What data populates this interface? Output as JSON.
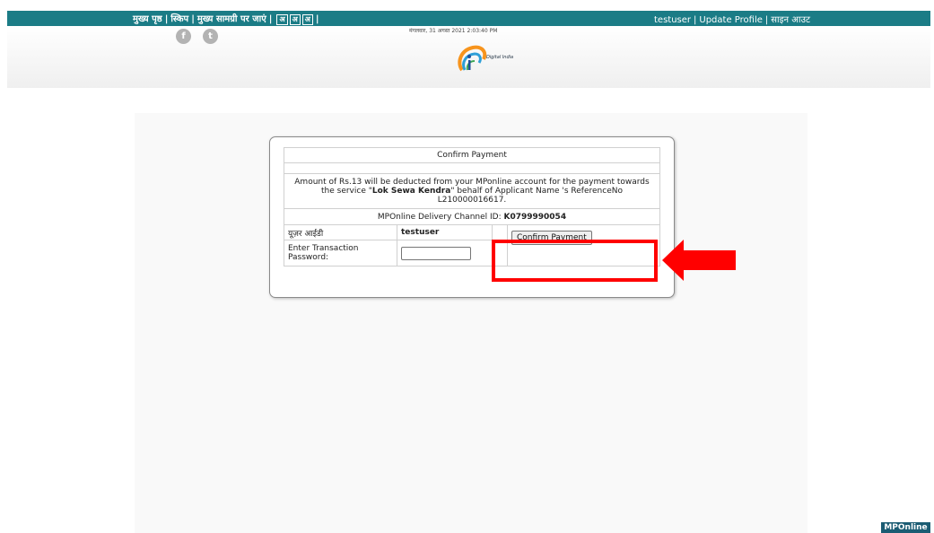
{
  "topbar": {
    "home": "मुख्य पृष्ठ",
    "skip": "स्किप",
    "main_content": "मुख्य सामग्री पर जाएं",
    "font_small": "अ",
    "font_normal": "अ",
    "font_large": "अ",
    "separator": "|",
    "username": "testuser",
    "update_profile": "Update Profile",
    "sign_out": "साइन आउट",
    "background": "#1b7c86"
  },
  "header": {
    "datetime": "मंगलवार, 31 अगस्त 2021 2:03:40 PM",
    "logo_text": "Digital India",
    "facebook_glyph": "f",
    "twitter_glyph": "t",
    "icons": [
      "facebook-icon",
      "twitter-icon",
      "digital-india-logo"
    ]
  },
  "payment": {
    "title": "Confirm Payment",
    "message_prefix": "Amount of Rs.13 will be deducted from your MPonline account for the payment towards the service \"",
    "service_name": "Lok Sewa Kendra",
    "message_suffix": "\" behalf of Applicant Name 's ReferenceNo L210000016617.",
    "channel_label": "MPOnline Delivery Channel ID: ",
    "channel_id": "K0799990054",
    "user_id_label": "यूज़र आईडी",
    "user_id_value": "testuser",
    "password_label": "Enter Transaction Password:",
    "password_value": "",
    "confirm_button": "Confirm Payment"
  },
  "annotation": {
    "highlight_color": "#ff0000"
  },
  "footer": {
    "badge": "MPOnline"
  }
}
